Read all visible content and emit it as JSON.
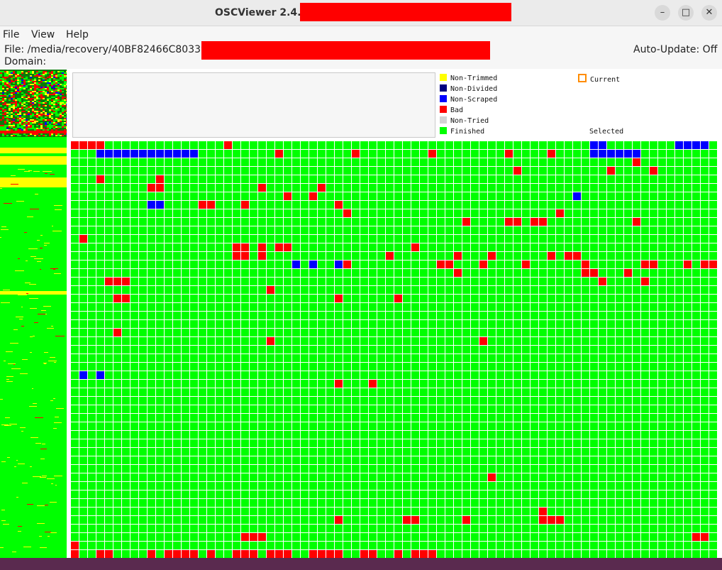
{
  "window": {
    "title": "OSCViewer 2.4.1",
    "controls": {
      "minimize": "–",
      "maximize": "□",
      "close": "✕"
    }
  },
  "menu": {
    "items": [
      "File",
      "View",
      "Help"
    ]
  },
  "info": {
    "file_line": "File: /media/recovery/40BF82466C803395",
    "domain_line": "Domain:",
    "auto_update": "Auto-Update: Off"
  },
  "legend": {
    "items": [
      {
        "label": "Non-Trimmed",
        "color": "#ffff00"
      },
      {
        "label": "Non-Divided",
        "color": "#00007f"
      },
      {
        "label": "Non-Scraped",
        "color": "#0000ff"
      },
      {
        "label": "Bad",
        "color": "#ff0000"
      },
      {
        "label": "Non-Tried",
        "color": "#d3d3d3"
      },
      {
        "label": "Finished",
        "color": "#00ff00"
      }
    ],
    "current_label": "Current",
    "current_color": "#ff8c00",
    "selected_label": "Selected"
  },
  "colors": {
    "finished": "#00ff00",
    "bad": "#ff0000",
    "non_scraped": "#0000ff",
    "non_trimmed": "#ffff00"
  }
}
